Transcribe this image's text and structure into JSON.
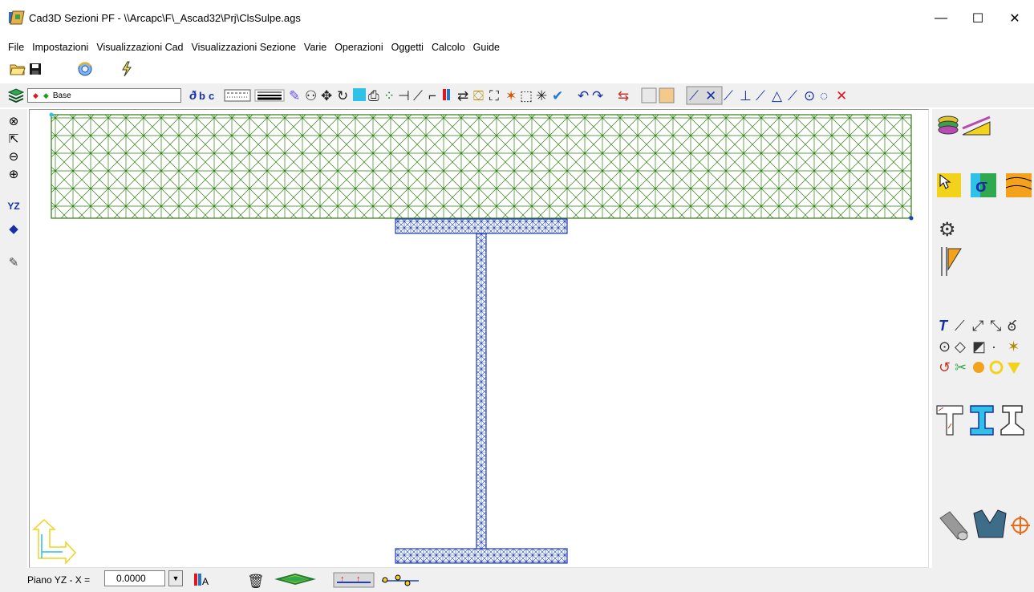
{
  "window": {
    "title": "Cad3D Sezioni PF - \\\\Arcapc\\F\\_Ascad32\\Prj\\ClsSulpe.ags",
    "minimize_glyph": "—",
    "maximize_glyph": "☐",
    "close_glyph": "✕"
  },
  "menu": {
    "items": [
      "File",
      "Impostazioni",
      "Visualizzazioni Cad",
      "Visualizzazioni Sezione",
      "Varie",
      "Operazioni",
      "Oggetti",
      "Calcolo",
      "Guide"
    ]
  },
  "layer": {
    "current": "Base"
  },
  "status": {
    "plane_label": "Piano YZ - X =",
    "x_value": "0.0000"
  },
  "colors": {
    "slab_mesh": "#2e7d10",
    "beam_mesh": "#1d3fb8",
    "axis_gizmo": "#f2d21b",
    "axis_gizmo_cyan": "#27c2e6"
  },
  "icons": {
    "toolbar1": [
      "open-folder-icon",
      "save-icon",
      "render-icon",
      "lightning-icon"
    ],
    "left": [
      "zoom-window-icon",
      "zoom-pan-icon",
      "zoom-all-icon",
      "zoom-extents-icon",
      "view-yz-icon",
      "3d-view-icon",
      "paint-bucket-icon"
    ],
    "right": [
      "layers-icon",
      "section-cut-icon",
      "select-area-icon",
      "sigma-stress-icon",
      "strata-icon",
      "settings-gear-icon",
      "reinforcement-icon",
      "text-icon",
      "line-icon",
      "circle-icon",
      "t-section-icon",
      "i-section-icon",
      "rail-section-icon",
      "cylinder-icon",
      "solid-icon",
      "target-icon"
    ]
  }
}
